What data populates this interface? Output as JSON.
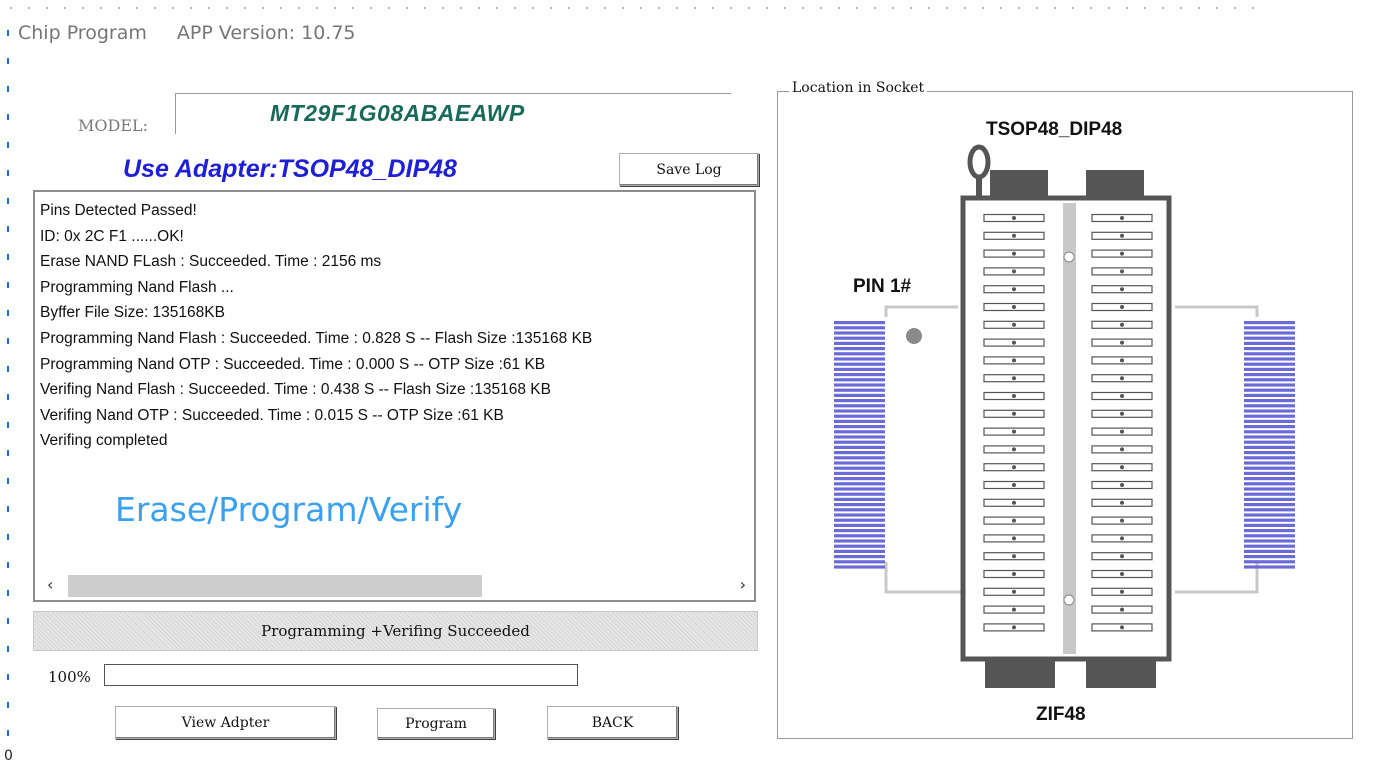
{
  "window": {
    "title": "Chip Program",
    "app_version": "APP Version: 10.75"
  },
  "model": {
    "label": "MODEL:",
    "value": "MT29F1G08ABAEAWP"
  },
  "adapter": {
    "text": "Use Adapter:TSOP48_DIP48"
  },
  "buttons": {
    "save_log": "Save Log",
    "view_adapter": "View Adpter",
    "program": "Program",
    "back": "BACK"
  },
  "log": {
    "lines": [
      "Pins Detected Passed!",
      "ID: 0x 2C F1  ......OK!",
      "Erase NAND FLash : Succeeded. Time : 2156 ms",
      "Programming Nand Flash ...",
      "Byffer File Size: 135168KB",
      "Programming Nand Flash : Succeeded. Time : 0.828 S --  Flash Size :135168 KB",
      "Programming Nand OTP : Succeeded. Time : 0.000 S --  OTP Size :61 KB",
      "Verifing Nand Flash : Succeeded. Time : 0.438 S --  Flash Size :135168 KB",
      "Verifing Nand OTP : Succeeded. Time : 0.015 S --  OTP Size :61 KB",
      "Verifing completed"
    ],
    "watermark": "Erase/Program/Verify",
    "scroll_left_icon": "chevron-left-icon",
    "scroll_right_icon": "chevron-right-icon"
  },
  "status": {
    "text": "Programming +Verifing  Succeeded"
  },
  "progress": {
    "label": "100%",
    "fraction": 1.0
  },
  "socket": {
    "legend": "Location in Socket",
    "adapter_name": "TSOP48_DIP48",
    "pin1_label": "PIN 1#",
    "zif_label": "ZIF48",
    "colors": {
      "chip_pins": "#6a6ad8",
      "socket_body": "#555555",
      "rail": "#c8c8c8",
      "pin1_dot": "#8a8a8a"
    }
  },
  "misc": {
    "corner_char": "0"
  }
}
